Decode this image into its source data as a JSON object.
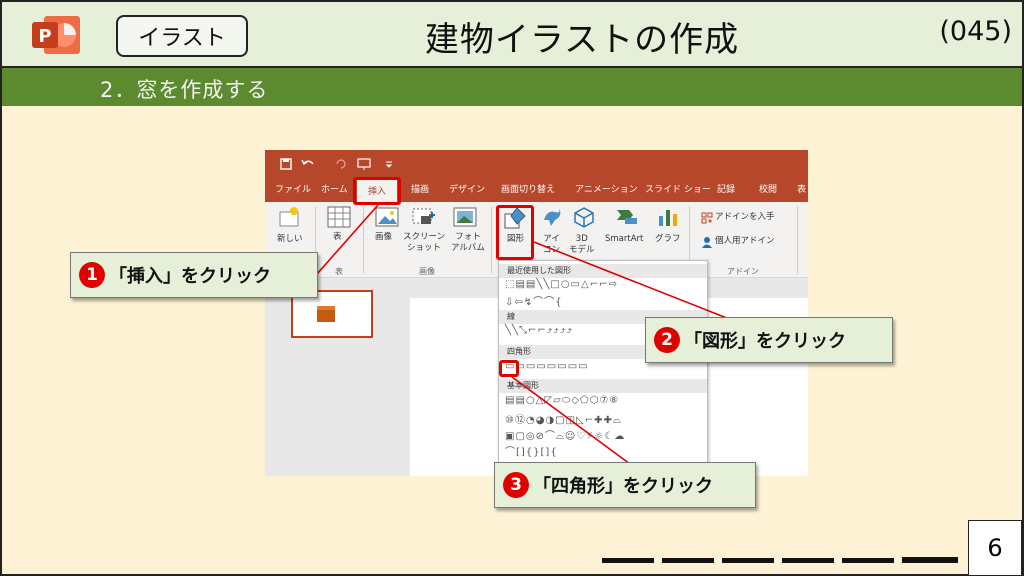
{
  "header": {
    "tag": "イラスト",
    "title": "建物イラストの作成",
    "code": "(045)"
  },
  "subtitle": "2．窓を作成する",
  "ribbon": {
    "tabs": [
      "ファイル",
      "ホーム",
      "挿入",
      "描画",
      "デザイン",
      "画面切り替え",
      "アニメーション",
      "スライド ショー",
      "記録",
      "校閲",
      "表"
    ],
    "active_tab": "挿入",
    "buttons": {
      "new_slide": "新しい",
      "table": "表",
      "image": "画像",
      "screenshot": "スクリーン\nショット",
      "photo_album": "フォト\nアルバム",
      "shapes": "図形",
      "icons": "アイ\nコン",
      "models_3d": "3D\nモデル",
      "smartart": "SmartArt",
      "chart": "グラフ",
      "get_addins": "アドインを入手",
      "my_addins": "個人用アドイン"
    },
    "groups": {
      "table": "表",
      "image": "画像",
      "addins": "アドイン"
    }
  },
  "dropdown": {
    "recent": "最近使用した図形",
    "lines": "線",
    "rectangles": "四角形",
    "basic": "基本図形"
  },
  "callouts": {
    "c1_num": "1",
    "c1_text": "「挿入」をクリック",
    "c2_num": "2",
    "c2_text": "「図形」をクリック",
    "c3_num": "3",
    "c3_text": "「四角形」をクリック"
  },
  "page_number": "6",
  "colors": {
    "header_bg": "#e6efd8",
    "subbar_bg": "#5c8a2f",
    "slide_bg": "#fdf2d4",
    "ppt_red": "#b7472a",
    "highlight_red": "#e00000"
  }
}
